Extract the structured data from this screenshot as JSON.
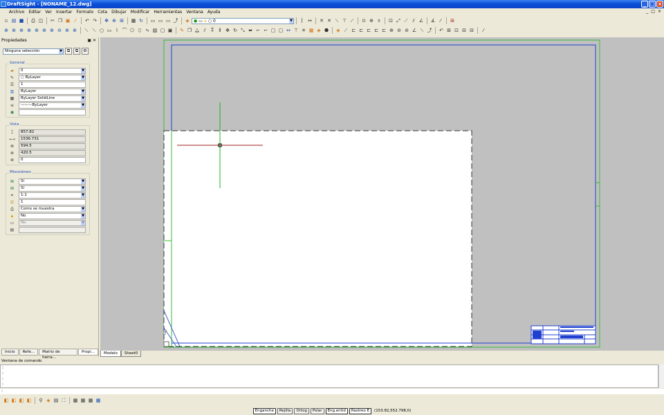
{
  "window": {
    "title": "DraftSight - [NONAME_12.dwg]",
    "buttons": [
      "_",
      "□",
      "×"
    ]
  },
  "menu": {
    "items": [
      "Archivo",
      "Editar",
      "Ver",
      "Insertar",
      "Formato",
      "Cota",
      "Dibujar",
      "Modificar",
      "Herramientas",
      "Ventana",
      "Ayuda"
    ],
    "doc_buttons": [
      "_",
      "□",
      "×"
    ]
  },
  "layer": {
    "value": "0"
  },
  "properties": {
    "title": "Propiedades",
    "selection": "Ninguna selección",
    "general": {
      "label": "General",
      "rows": [
        {
          "icon": "layer-icon",
          "value": "0"
        },
        {
          "icon": "color-icon",
          "value": "ByLayer"
        },
        {
          "icon": "linescale-icon",
          "value": "1"
        },
        {
          "icon": "lineweight-icon",
          "value": "ByLayer"
        },
        {
          "icon": "linestyle-icon",
          "value": "ByLayer     SolidLine"
        },
        {
          "icon": "lineweight2-icon",
          "value": "———ByLayer"
        },
        {
          "icon": "hyperlink-icon",
          "value": ""
        }
      ]
    },
    "view": {
      "label": "Vista",
      "rows": [
        {
          "icon": "height-icon",
          "value": "857.82"
        },
        {
          "icon": "width-icon",
          "value": "1536.731"
        },
        {
          "icon": "center-x-icon",
          "value": "594.5"
        },
        {
          "icon": "center-y-icon",
          "value": "420.5"
        },
        {
          "icon": "center-z-icon",
          "value": "0"
        }
      ]
    },
    "misc": {
      "label": "Misceláneo",
      "rows": [
        {
          "icon": "ucs-icon",
          "value": "Sí",
          "dropdown": true
        },
        {
          "icon": "ucs-origin-icon",
          "value": "Sí",
          "dropdown": true
        },
        {
          "icon": "scale-icon",
          "value": "1:1",
          "dropdown": true
        },
        {
          "icon": "annoscale-icon",
          "value": "1",
          "dropdown": false
        },
        {
          "icon": "print-icon",
          "value": "Como se muestra",
          "dropdown": true
        },
        {
          "icon": "lock-icon",
          "value": "No",
          "dropdown": true
        },
        {
          "icon": "viewport-icon",
          "value": "No",
          "dropdown": true,
          "disabled": true
        },
        {
          "icon": "clip-icon",
          "value": "",
          "dropdown": false
        }
      ]
    },
    "tabs": [
      "Inicio",
      "Refe...",
      "Matriz de herra...",
      "Propi..."
    ]
  },
  "sheets": [
    "Modelo",
    "Sheet0"
  ],
  "command": {
    "title": "Ventana de comando",
    "lines": [
      ":",
      ":",
      ":",
      ":"
    ],
    "input": ":"
  },
  "status": {
    "buttons": [
      "Enganche",
      "Rejilla",
      "Ortog",
      "Polar",
      "Eng.entid",
      "Rastreo E"
    ],
    "coords": "(153.82,552.798,0)"
  }
}
